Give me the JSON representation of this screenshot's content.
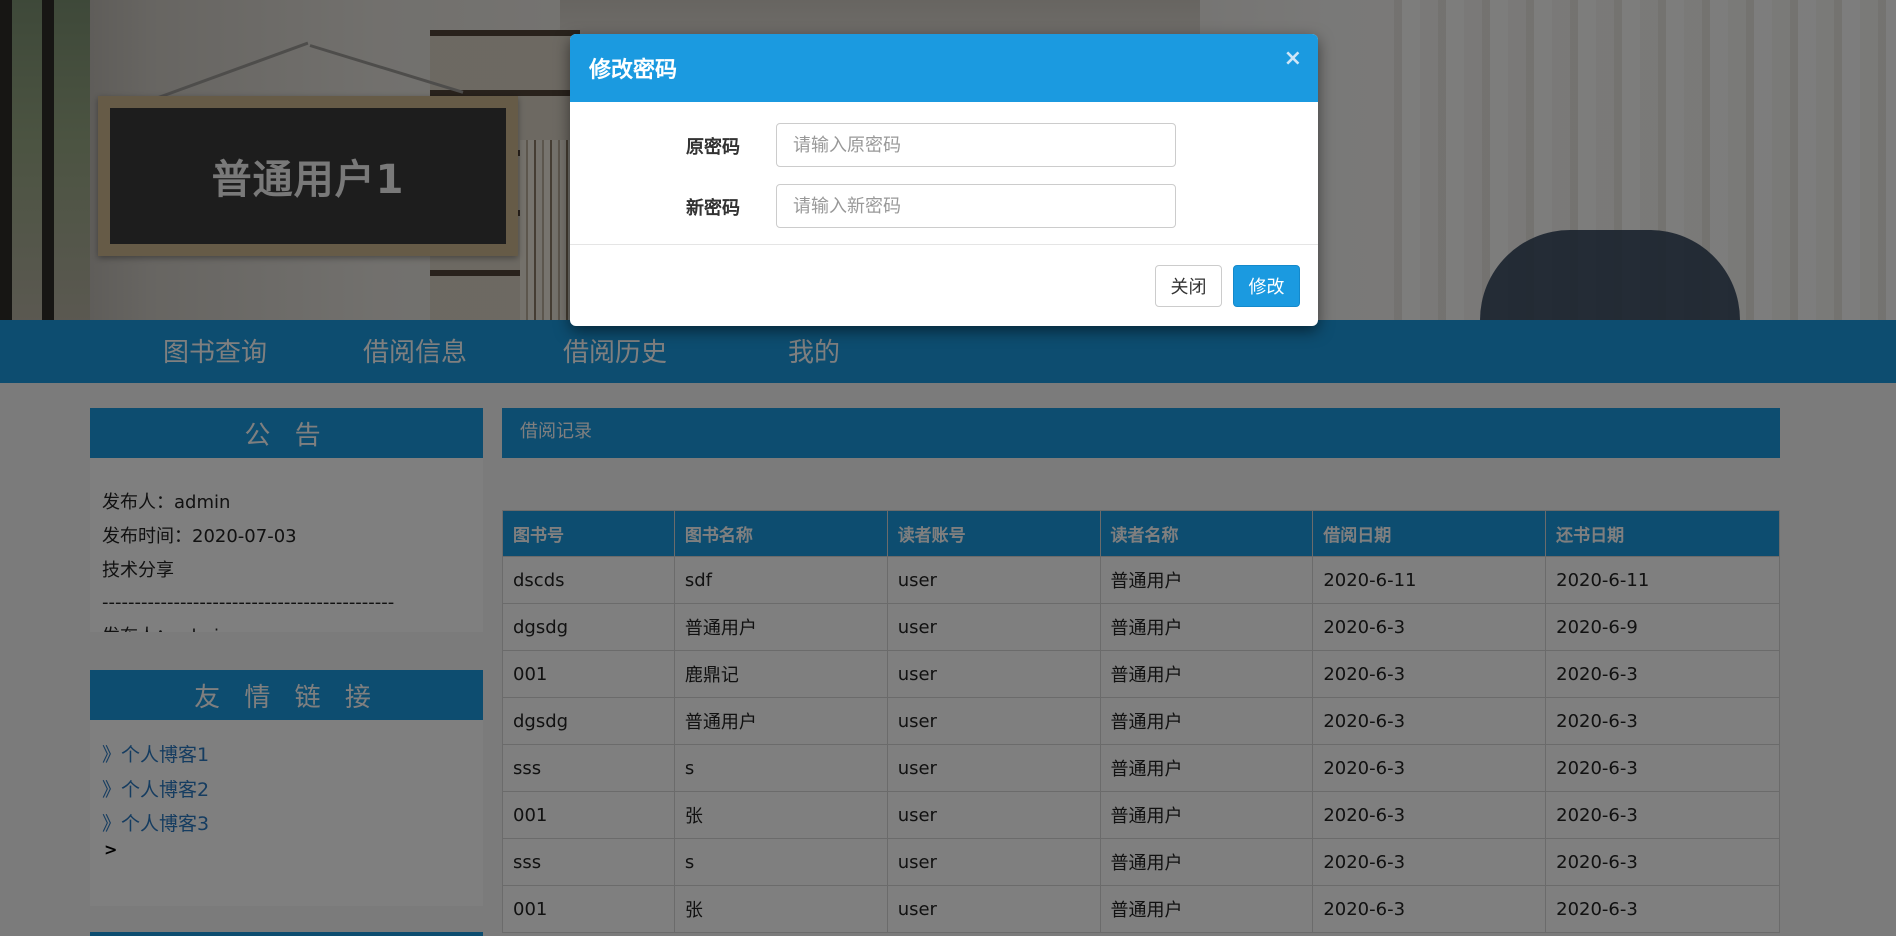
{
  "banner": {
    "sign_text": "普通用户1"
  },
  "nav": {
    "items": [
      "图书查询",
      "借阅信息",
      "借阅历史",
      "我的"
    ]
  },
  "notice": {
    "title": "公 告",
    "publisher": "发布人：admin",
    "publish_time": "发布时间：2020-07-03",
    "content": "技术分享",
    "separator": "---------------------------------------------",
    "next_publisher": "发布人：admin"
  },
  "links": {
    "title": "友 情 链 接",
    "items": [
      "》个人博客1",
      "》个人博客2",
      "》个人博客3"
    ],
    "extra": ">"
  },
  "records": {
    "header_label": "借阅记录",
    "columns": [
      "图书号",
      "图书名称",
      "读者账号",
      "读者名称",
      "借阅日期",
      "还书日期"
    ],
    "rows": [
      [
        "dscds",
        "sdf",
        "user",
        "普通用户",
        "2020-6-11",
        "2020-6-11"
      ],
      [
        "dgsdg",
        "普通用户",
        "user",
        "普通用户",
        "2020-6-3",
        "2020-6-9"
      ],
      [
        "001",
        "鹿鼎记",
        "user",
        "普通用户",
        "2020-6-3",
        "2020-6-3"
      ],
      [
        "dgsdg",
        "普通用户",
        "user",
        "普通用户",
        "2020-6-3",
        "2020-6-3"
      ],
      [
        "sss",
        "s",
        "user",
        "普通用户",
        "2020-6-3",
        "2020-6-3"
      ],
      [
        "001",
        "张",
        "user",
        "普通用户",
        "2020-6-3",
        "2020-6-3"
      ],
      [
        "sss",
        "s",
        "user",
        "普通用户",
        "2020-6-3",
        "2020-6-3"
      ],
      [
        "001",
        "张",
        "user",
        "普通用户",
        "2020-6-3",
        "2020-6-3"
      ]
    ]
  },
  "modal": {
    "title": "修改密码",
    "close_symbol": "×",
    "old_password_label": "原密码",
    "old_password_placeholder": "请输入原密码",
    "old_password_value": "",
    "new_password_label": "新密码",
    "new_password_placeholder": "请输入新密码",
    "new_password_value": "",
    "close_button": "关闭",
    "submit_button": "修改"
  },
  "colors": {
    "primary": "#1b9ae0",
    "link": "#2a78c0",
    "overlay": "rgba(0,0,0,0.5)"
  }
}
